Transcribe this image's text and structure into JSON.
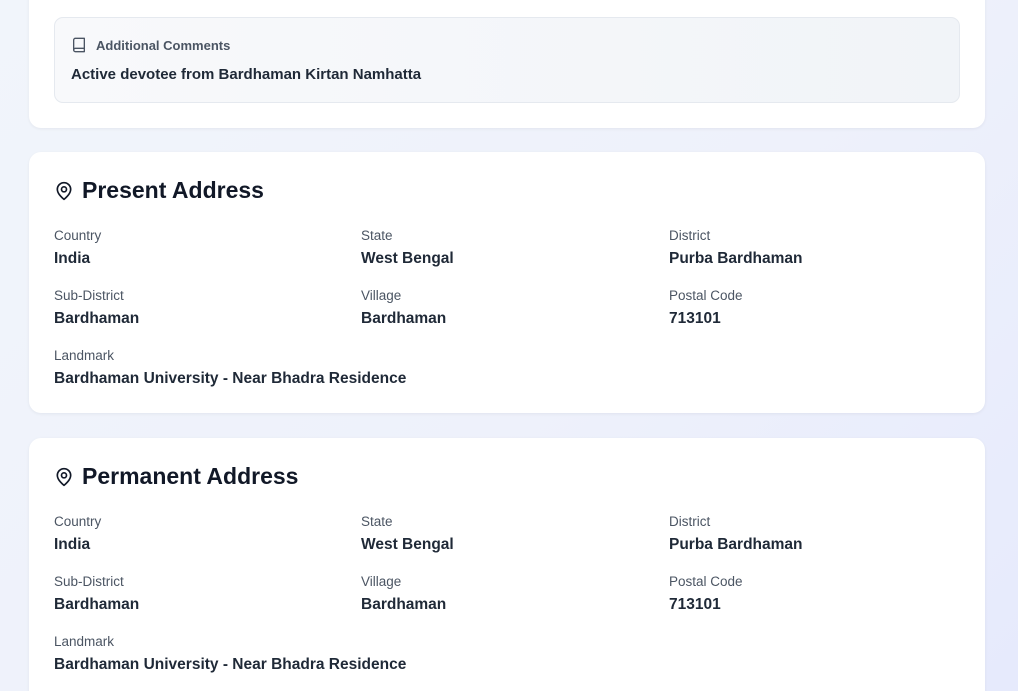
{
  "additional_comments": {
    "label": "Additional Comments",
    "text": "Active devotee from Bardhaman Kirtan Namhatta"
  },
  "present_address": {
    "title": "Present Address",
    "country": {
      "label": "Country",
      "value": "India"
    },
    "state": {
      "label": "State",
      "value": "West Bengal"
    },
    "district": {
      "label": "District",
      "value": "Purba Bardhaman"
    },
    "sub_district": {
      "label": "Sub-District",
      "value": "Bardhaman"
    },
    "village": {
      "label": "Village",
      "value": "Bardhaman"
    },
    "postal_code": {
      "label": "Postal Code",
      "value": "713101"
    },
    "landmark": {
      "label": "Landmark",
      "value": "Bardhaman University - Near Bhadra Residence"
    }
  },
  "permanent_address": {
    "title": "Permanent Address",
    "country": {
      "label": "Country",
      "value": "India"
    },
    "state": {
      "label": "State",
      "value": "West Bengal"
    },
    "district": {
      "label": "District",
      "value": "Purba Bardhaman"
    },
    "sub_district": {
      "label": "Sub-District",
      "value": "Bardhaman"
    },
    "village": {
      "label": "Village",
      "value": "Bardhaman"
    },
    "postal_code": {
      "label": "Postal Code",
      "value": "713101"
    },
    "landmark": {
      "label": "Landmark",
      "value": "Bardhaman University - Near Bhadra Residence"
    }
  },
  "icons": {
    "comments": "book-icon",
    "address": "map-pin-icon"
  }
}
